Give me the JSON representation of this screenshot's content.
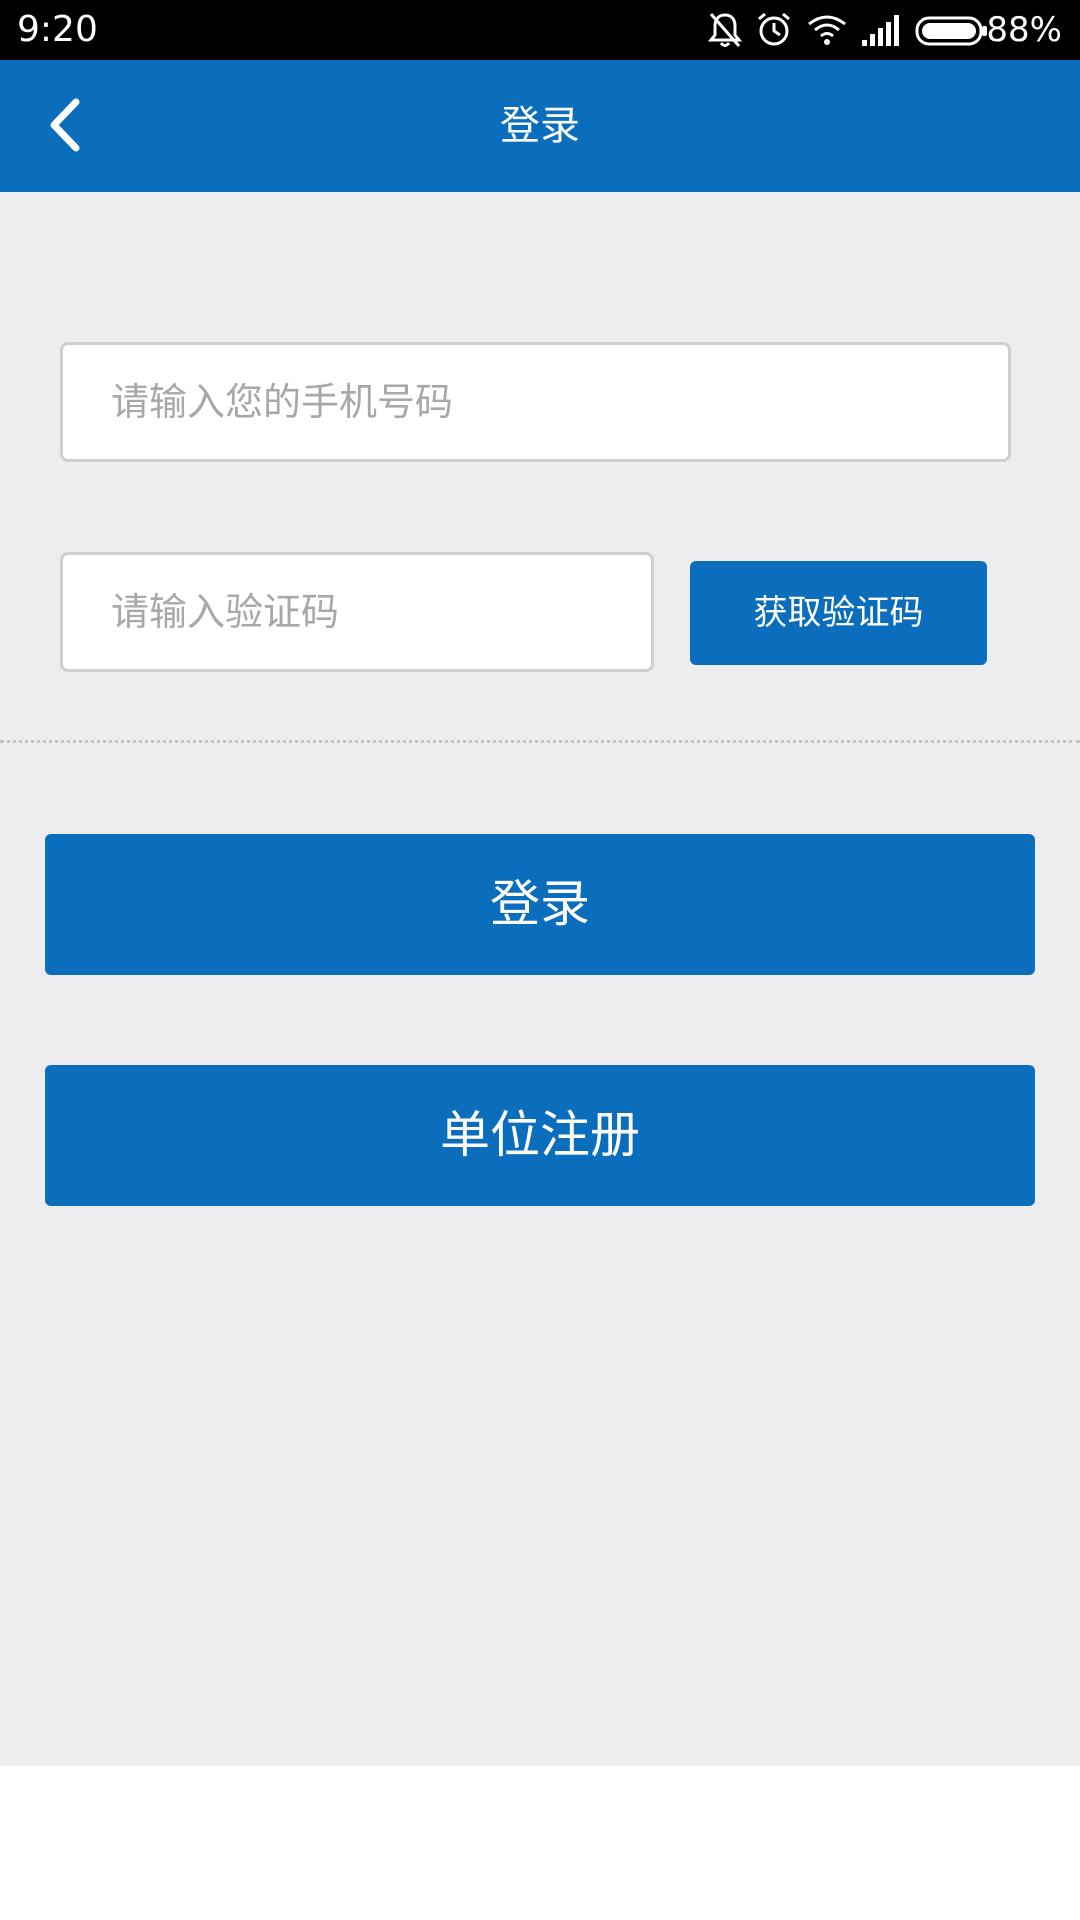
{
  "status_bar": {
    "time": "9:20",
    "battery": "88%",
    "icons": [
      "bell-off-icon",
      "alarm-icon",
      "wifi-icon",
      "signal-icon",
      "battery-icon"
    ]
  },
  "header": {
    "title": "登录",
    "back_icon": "chevron-left-icon"
  },
  "form": {
    "phone_placeholder": "请输入您的手机号码",
    "code_placeholder": "请输入验证码",
    "get_code_label": "获取验证码"
  },
  "actions": {
    "login_label": "登录",
    "register_label": "单位注册"
  },
  "colors": {
    "primary": "#0a6ebd",
    "background": "#ededf0",
    "status_bar": "#000000"
  }
}
